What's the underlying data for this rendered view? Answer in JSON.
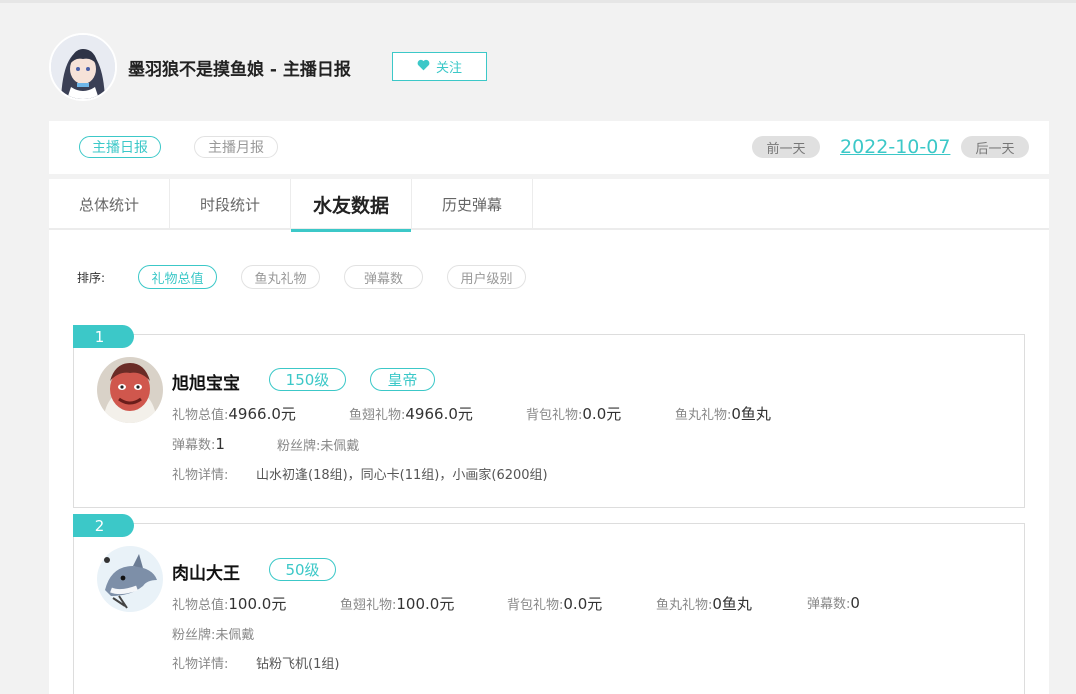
{
  "header": {
    "title": "墨羽狼不是摸鱼娘 - 主播日报",
    "follow_label": "关注",
    "follow_icon": "heart-icon"
  },
  "report_bar": {
    "daily_label": "主播日报",
    "monthly_label": "主播月报",
    "prev_label": "前一天",
    "date": "2022-10-07",
    "next_label": "后一天"
  },
  "tabs": [
    {
      "label": "总体统计"
    },
    {
      "label": "时段统计"
    },
    {
      "label": "水友数据"
    },
    {
      "label": "历史弹幕"
    }
  ],
  "sort": {
    "label": "排序:",
    "options": [
      {
        "label": "礼物总值"
      },
      {
        "label": "鱼丸礼物"
      },
      {
        "label": "弹幕数"
      },
      {
        "label": "用户级别"
      }
    ]
  },
  "users": [
    {
      "rank": "1",
      "name": "旭旭宝宝",
      "level": "150级",
      "noble": "皇帝",
      "gift_total_label": "礼物总值:",
      "gift_total": "4966.0元",
      "fish_wing_label": "鱼翅礼物:",
      "fish_wing": "4966.0元",
      "backpack_label": "背包礼物:",
      "backpack": "0.0元",
      "fish_ball_label": "鱼丸礼物:",
      "fish_ball": "0鱼丸",
      "danmu_label": "弹幕数:",
      "danmu": "1",
      "fan_badge_label": "粉丝牌:",
      "fan_badge": "未佩戴",
      "detail_label": "礼物详情:",
      "detail": "山水初逢(18组)，同心卡(11组)，小画家(6200组)"
    },
    {
      "rank": "2",
      "name": "肉山大王",
      "level": "50级",
      "gift_total_label": "礼物总值:",
      "gift_total": "100.0元",
      "fish_wing_label": "鱼翅礼物:",
      "fish_wing": "100.0元",
      "backpack_label": "背包礼物:",
      "backpack": "0.0元",
      "fish_ball_label": "鱼丸礼物:",
      "fish_ball": "0鱼丸",
      "danmu_label": "弹幕数:",
      "danmu": "0",
      "fan_badge_label": "粉丝牌:",
      "fan_badge": "未佩戴",
      "detail_label": "礼物详情:",
      "detail": "钻粉飞机(1组)"
    }
  ],
  "colors": {
    "accent": "#3cc8c8",
    "background": "#f2f2f2"
  }
}
